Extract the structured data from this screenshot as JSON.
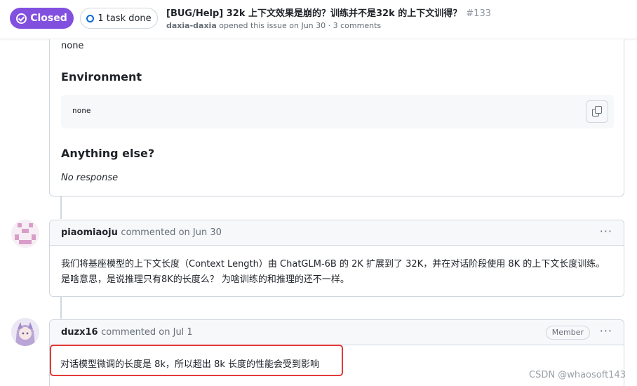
{
  "header": {
    "state_label": "Closed",
    "task_label": "1 task done",
    "title": "[BUG/Help] 32k 上下文效果是崩的？训练并不是32k 的上下文训得？",
    "number": "#133",
    "meta_author": "daxia-daxia",
    "meta_rest": "opened this issue on Jun 30 · 3 comments"
  },
  "issue_body": {
    "top_text": "none",
    "env_heading": "Environment",
    "env_code": "none",
    "else_heading": "Anything else?",
    "else_text": "No response"
  },
  "comments": [
    {
      "author": "piaomiaoju",
      "action": "commented on Jun 30",
      "menu": "···",
      "body": "我们将基座模型的上下文长度（Context Length）由 ChatGLM-6B 的 2K 扩展到了 32K，并在对话阶段使用 8K 的上下文长度训练。是啥意思，是说推理只有8K的长度么？ 为啥训练的和推理的还不一样。"
    },
    {
      "author": "duzx16",
      "action": "commented on Jul 1",
      "badge": "Member",
      "menu": "···",
      "body": "对话模型微调的长度是 8k，所以超出 8k 长度的性能会受到影响"
    }
  ],
  "watermark": "CSDN @whaosoft143",
  "colors": {
    "closed_purple": "#8250df",
    "task_blue": "#0969da",
    "highlight_red": "#e23a3a"
  }
}
